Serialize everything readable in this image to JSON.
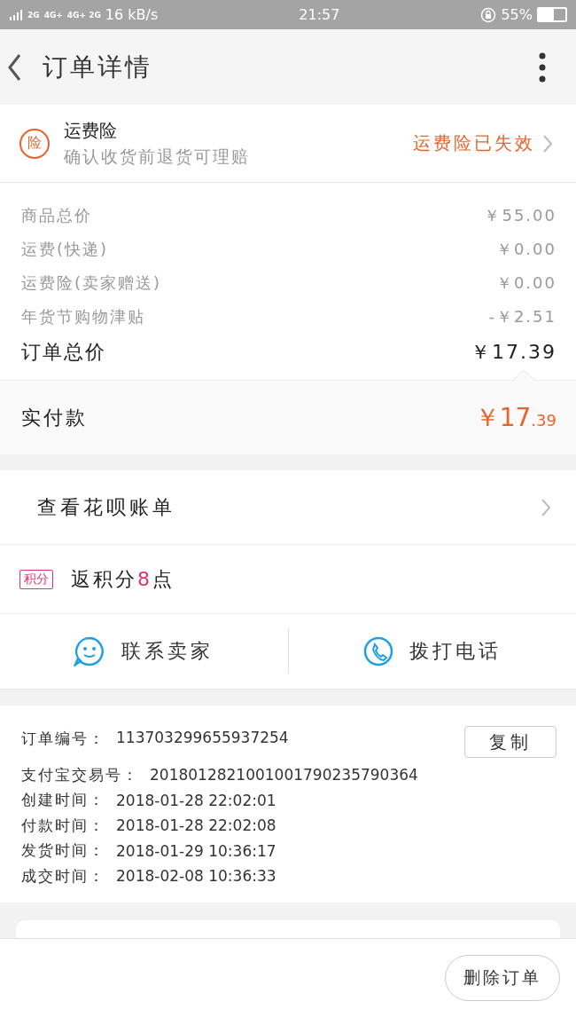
{
  "status_bar": {
    "networks": [
      "2G",
      "4G+",
      "4G+ 2G"
    ],
    "speed": "16 kB/s",
    "time": "21:57",
    "battery": "55%"
  },
  "header": {
    "title": "订单详情"
  },
  "insurance": {
    "badge": "险",
    "title": "运费险",
    "subtitle": "确认收货前退货可理赔",
    "status": "运费险已失效"
  },
  "price_rows": [
    {
      "label": "商品总价",
      "value": "￥55.00",
      "kind": "minor"
    },
    {
      "label": "运费(快递)",
      "value": "￥0.00",
      "kind": "minor"
    },
    {
      "label": "运费险(卖家赠送)",
      "value": "￥0.00",
      "kind": "minor"
    },
    {
      "label": "年货节购物津贴",
      "value": "-￥2.51",
      "kind": "minor"
    },
    {
      "label": "订单总价",
      "value": "￥17.39",
      "kind": "total"
    }
  ],
  "paid": {
    "label": "实付款",
    "value_main": "￥17",
    "value_cents": ".39"
  },
  "huabei": {
    "label": "查看花呗账单"
  },
  "points": {
    "badge": "积分",
    "prefix": "返积分",
    "count": "8",
    "suffix": "点"
  },
  "contact": [
    {
      "label": "联系卖家",
      "kind": "chat"
    },
    {
      "label": "拨打电话",
      "kind": "phone"
    }
  ],
  "order_info": {
    "copy_button": "复制",
    "lines": [
      {
        "label": "订单编号：",
        "value": "113703299655937254"
      },
      {
        "label": "支付宝交易号：",
        "value": "2018012821001001790235790364"
      },
      {
        "label": "创建时间：",
        "value": "2018-01-28 22:02:01"
      },
      {
        "label": "付款时间：",
        "value": "2018-01-28 22:02:08"
      },
      {
        "label": "发货时间：",
        "value": "2018-01-29 10:36:17"
      },
      {
        "label": "成交时间：",
        "value": "2018-02-08 10:36:33"
      }
    ]
  },
  "footer": {
    "button": "删除订单"
  }
}
